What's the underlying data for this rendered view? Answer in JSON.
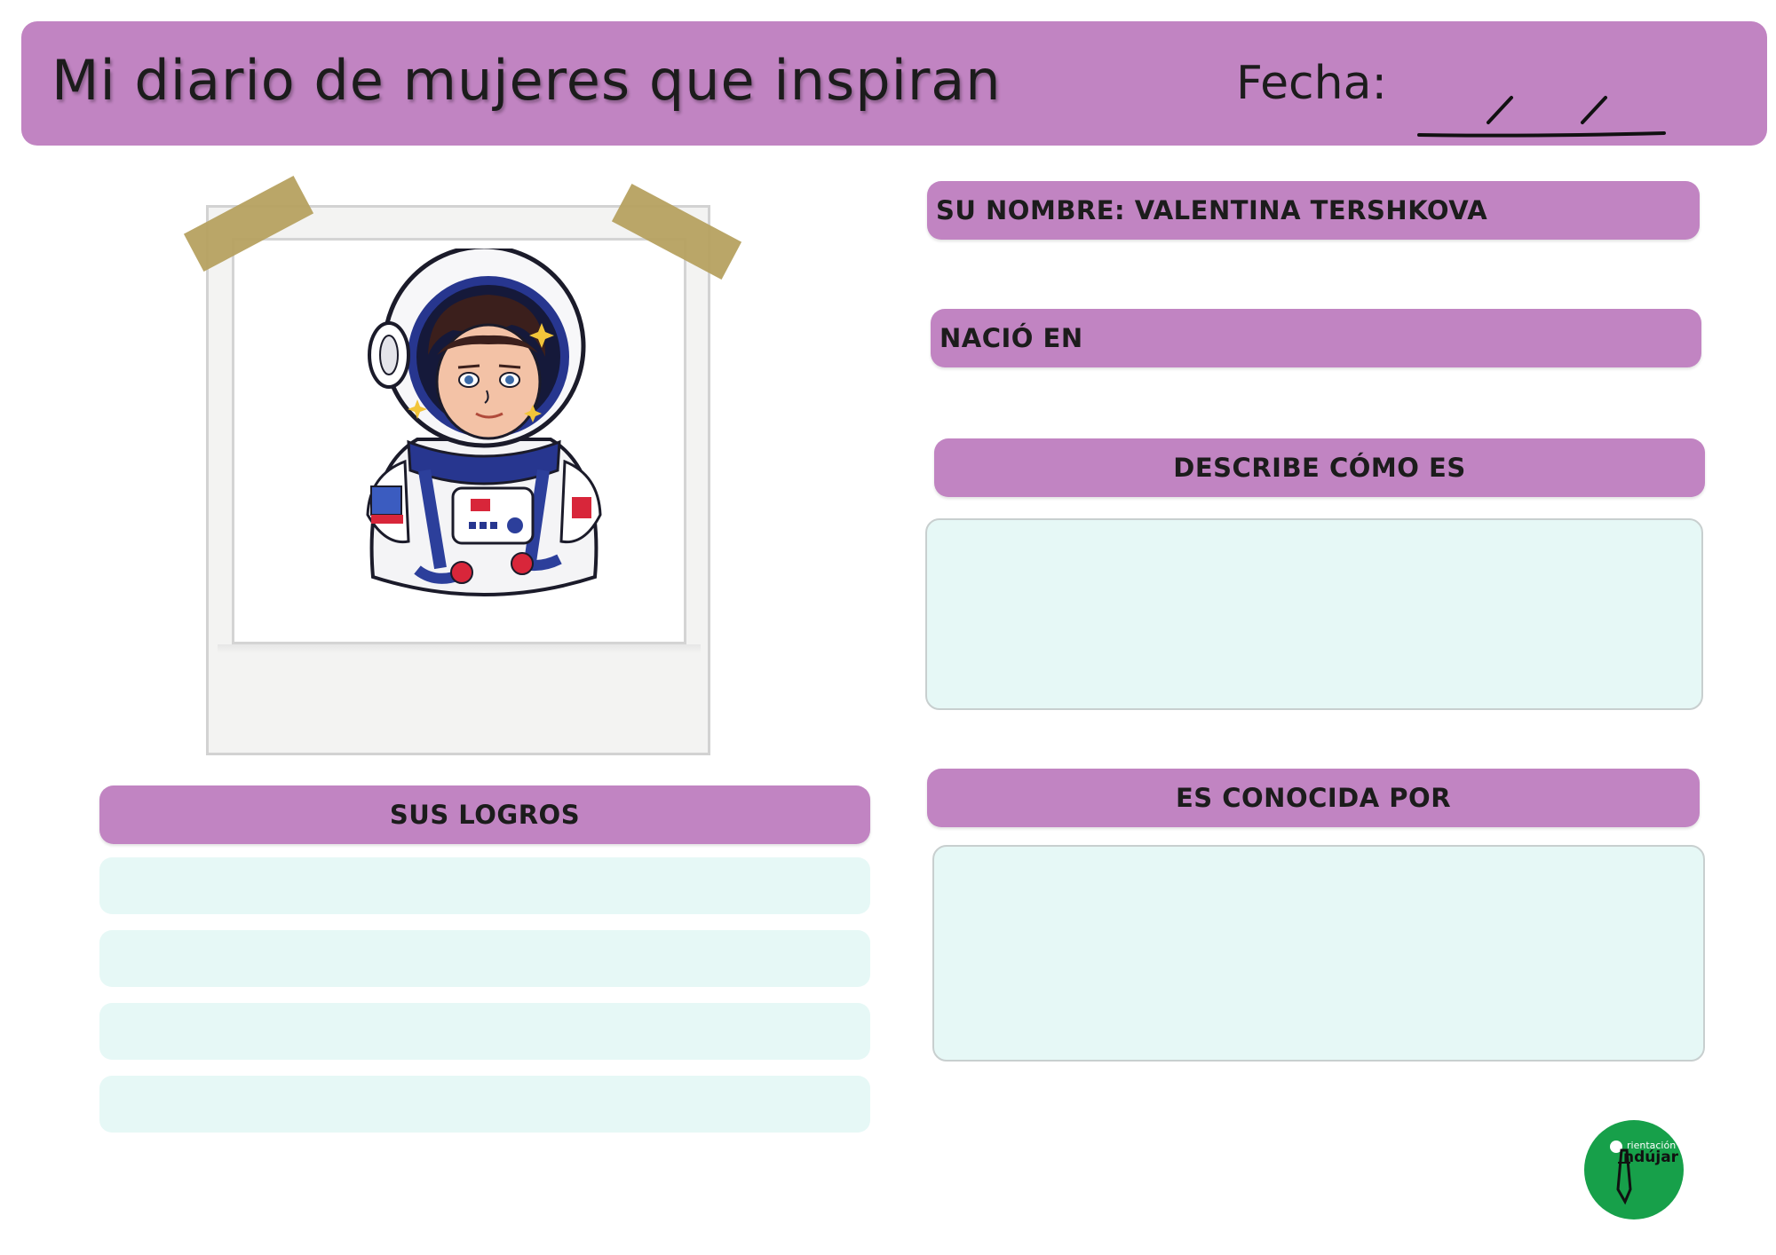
{
  "header": {
    "title": "Mi diario de mujeres que inspiran",
    "date_label": "Fecha:"
  },
  "fields": {
    "name_label": "SU NOMBRE: VALENTINA TERSHKOVA",
    "born_label": "NACIÓ EN",
    "describe_label": "DESCRIBE CÓMO ES",
    "known_for_label": "ES CONOCIDA POR",
    "achievements_label": "SUS LOGROS"
  },
  "logo": {
    "line1": "rientación",
    "line2": "ndújar"
  },
  "colors": {
    "accent": "#c184c2",
    "box_fill": "#e6f8f6",
    "logo_green": "#17a04a",
    "tape": "#b6a160"
  },
  "icons": {
    "photo": "astronaut-illustration",
    "logo": "orientacion-andujar-logo"
  }
}
